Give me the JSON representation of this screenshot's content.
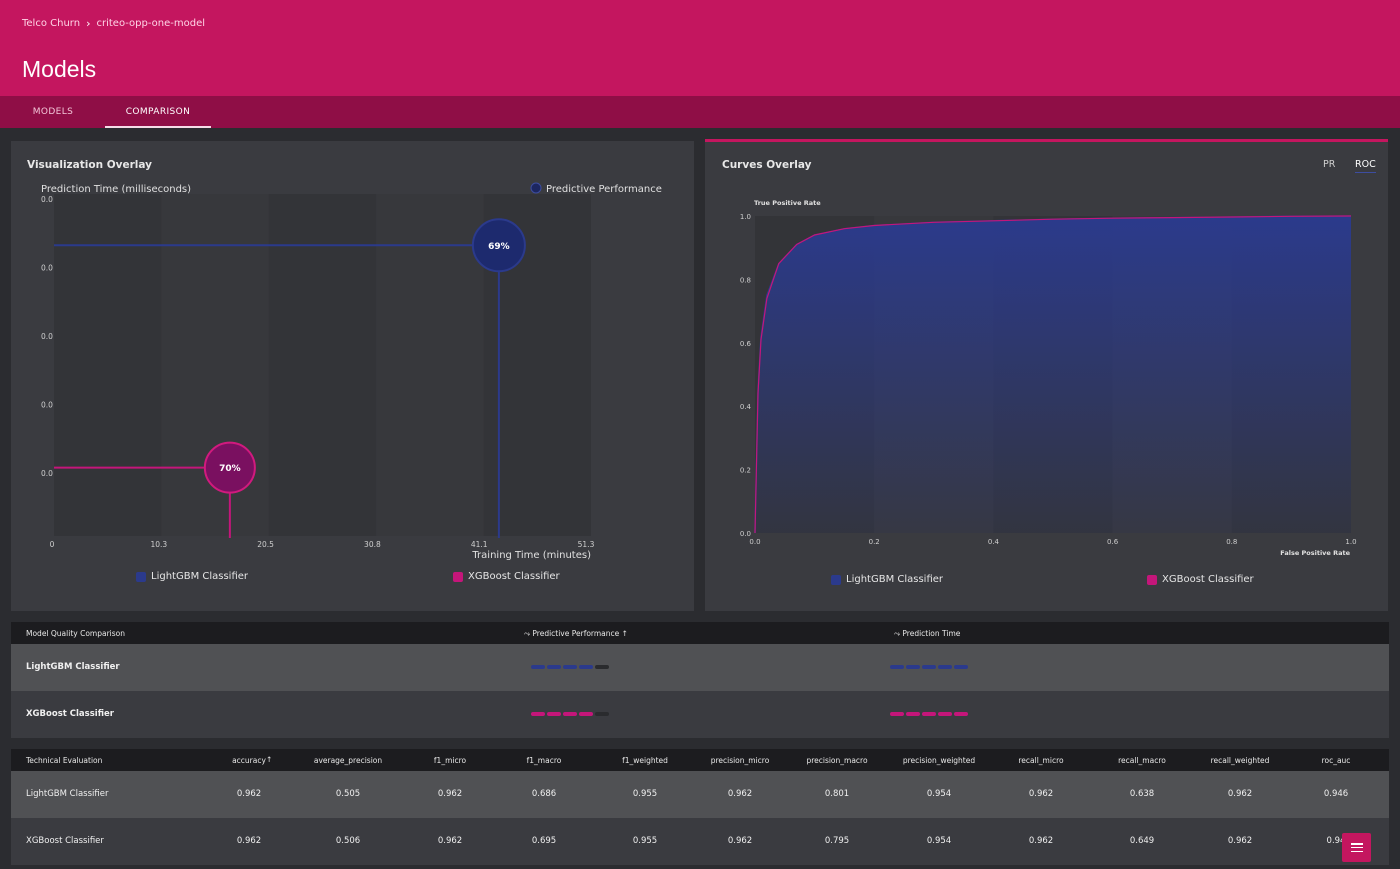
{
  "breadcrumb": {
    "project": "Telco Churn",
    "app": "criteo-opp-one-model"
  },
  "page_title": "Models",
  "tabs": [
    {
      "label": "MODELS",
      "active": false
    },
    {
      "label": "COMPARISON",
      "active": true
    }
  ],
  "colors": {
    "brand": "#c4165f",
    "brand_dark": "#8f0e46",
    "lightgbm": "#2b3a8c",
    "xgboost": "#c4167a"
  },
  "viz_panel": {
    "title": "Visualization Overlay",
    "legend_label": "Predictive Performance"
  },
  "curves_panel": {
    "title": "Curves Overlay",
    "toggle_pr": "PR",
    "toggle_roc": "ROC",
    "selected_toggle": "ROC"
  },
  "chart_data": [
    {
      "type": "scatter",
      "title": "Visualization Overlay",
      "xlabel": "Training Time (minutes)",
      "ylabel": "Prediction Time (milliseconds)",
      "xlim": [
        0,
        51.3
      ],
      "x_ticks": [
        "0",
        "10.3",
        "20.5",
        "30.8",
        "41.1",
        "51.3"
      ],
      "y_ticks": [
        "0.0",
        "0.0",
        "0.0",
        "0.0",
        "0.0"
      ],
      "size_legend": "Predictive Performance",
      "series": [
        {
          "name": "LightGBM Classifier",
          "x": 42.5,
          "y": 0.85,
          "label": "69%",
          "color": "#2b3a8c"
        },
        {
          "name": "XGBoost Classifier",
          "x": 16.8,
          "y": 0.2,
          "label": "70%",
          "color": "#c4167a"
        }
      ]
    },
    {
      "type": "area",
      "title": "Curves Overlay",
      "xlabel": "False Positive Rate",
      "ylabel": "True Positive Rate",
      "xlim": [
        0,
        1
      ],
      "ylim": [
        0,
        1
      ],
      "x_ticks": [
        "0.0",
        "0.2",
        "0.4",
        "0.6",
        "0.8",
        "1.0"
      ],
      "y_ticks": [
        "0.0",
        "0.2",
        "0.4",
        "0.6",
        "0.8",
        "1.0"
      ],
      "series": [
        {
          "name": "LightGBM Classifier",
          "color": "#2b3a8c",
          "x": [
            0,
            0.005,
            0.01,
            0.02,
            0.04,
            0.07,
            0.1,
            0.15,
            0.2,
            0.3,
            0.4,
            0.5,
            0.6,
            0.7,
            0.8,
            0.9,
            1.0
          ],
          "y": [
            0,
            0.45,
            0.62,
            0.75,
            0.85,
            0.91,
            0.94,
            0.96,
            0.97,
            0.98,
            0.985,
            0.99,
            0.993,
            0.995,
            0.997,
            0.999,
            1.0
          ]
        },
        {
          "name": "XGBoost Classifier",
          "color": "#c4167a",
          "x": [
            0,
            0.005,
            0.01,
            0.02,
            0.04,
            0.07,
            0.1,
            0.15,
            0.2,
            0.3,
            0.4,
            0.5,
            0.6,
            0.7,
            0.8,
            0.9,
            1.0
          ],
          "y": [
            0,
            0.44,
            0.61,
            0.74,
            0.85,
            0.91,
            0.94,
            0.96,
            0.97,
            0.98,
            0.985,
            0.99,
            0.993,
            0.995,
            0.997,
            0.999,
            1.0
          ]
        }
      ]
    }
  ],
  "legend": [
    "LightGBM Classifier",
    "XGBoost Classifier"
  ],
  "quality_table": {
    "headers": [
      "Model Quality Comparison",
      "Predictive Performance",
      "Prediction Time"
    ],
    "rows": [
      {
        "model": "LightGBM Classifier",
        "performance_level": 0.8,
        "prediction_time_level": 1.0,
        "color": "#2b3a8c"
      },
      {
        "model": "XGBoost Classifier",
        "performance_level": 0.8,
        "prediction_time_level": 1.0,
        "color": "#c4167a"
      }
    ]
  },
  "tech_table": {
    "headers": [
      "Technical Evaluation",
      "accuracy",
      "average_precision",
      "f1_micro",
      "f1_macro",
      "f1_weighted",
      "precision_micro",
      "precision_macro",
      "precision_weighted",
      "recall_micro",
      "recall_macro",
      "recall_weighted",
      "roc_auc"
    ],
    "rows": [
      [
        "LightGBM Classifier",
        "0.962",
        "0.505",
        "0.962",
        "0.686",
        "0.955",
        "0.962",
        "0.801",
        "0.954",
        "0.962",
        "0.638",
        "0.962",
        "0.946"
      ],
      [
        "XGBoost Classifier",
        "0.962",
        "0.506",
        "0.962",
        "0.695",
        "0.955",
        "0.962",
        "0.795",
        "0.954",
        "0.962",
        "0.649",
        "0.962",
        "0.94"
      ]
    ]
  }
}
